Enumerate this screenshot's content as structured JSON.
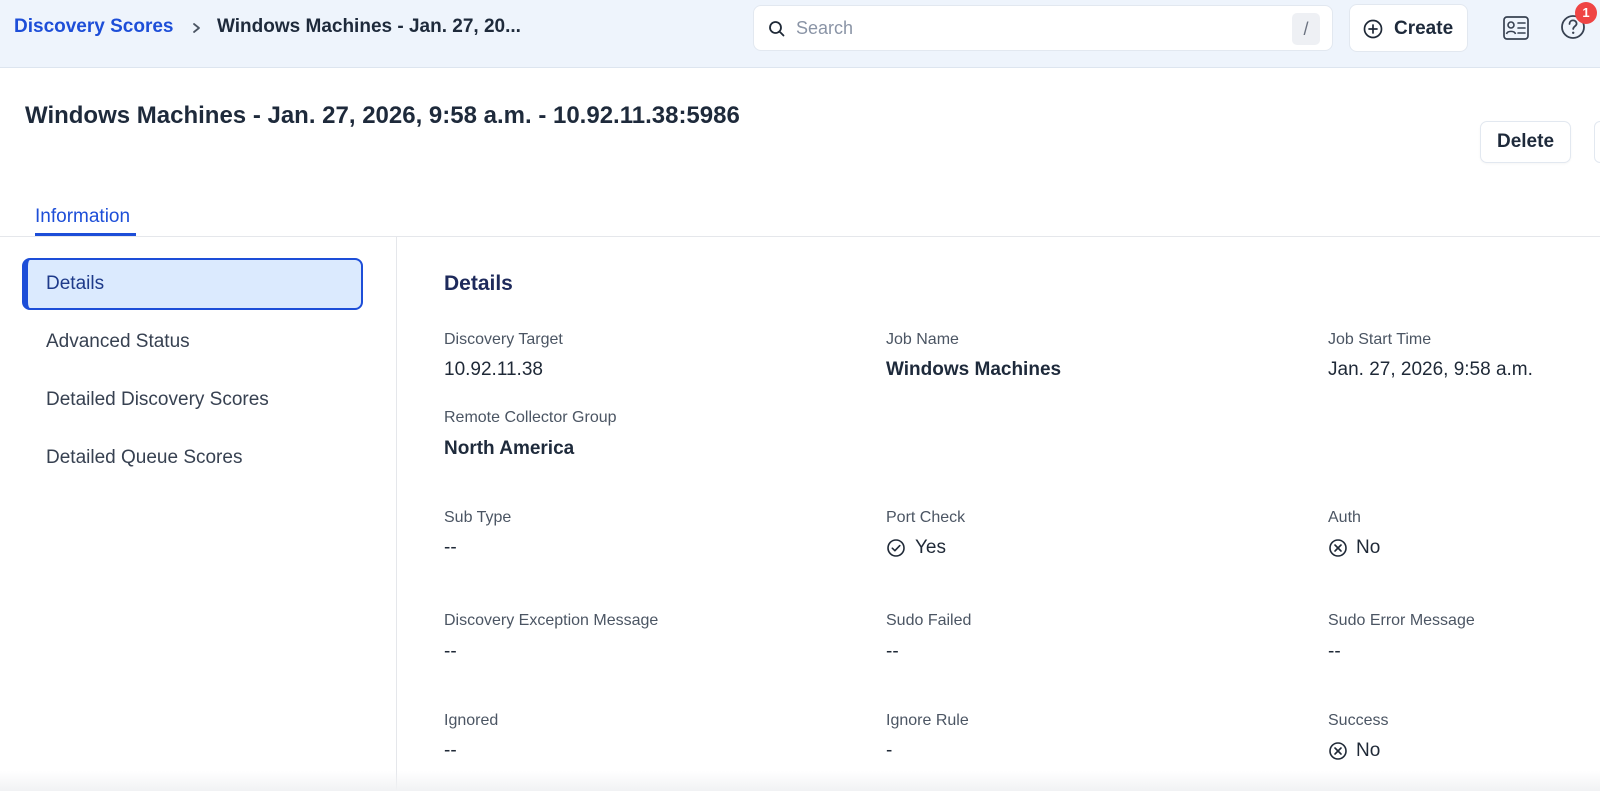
{
  "header": {
    "breadcrumb_link": "Discovery Scores",
    "breadcrumb_current": "Windows Machines - Jan. 27, 20...",
    "search_placeholder": "Search",
    "search_shortcut": "/",
    "create_label": "Create",
    "notification_count": "1"
  },
  "page": {
    "title": "Windows Machines - Jan. 27, 2026, 9:58 a.m. - 10.92.11.38:5986",
    "delete_label": "Delete",
    "tab_information": "Information"
  },
  "nav": {
    "items": [
      {
        "label": "Details",
        "active": true
      },
      {
        "label": "Advanced Status",
        "active": false
      },
      {
        "label": "Detailed Discovery Scores",
        "active": false
      },
      {
        "label": "Detailed Queue Scores",
        "active": false
      }
    ]
  },
  "details": {
    "title": "Details",
    "fields": {
      "discovery_target": {
        "label": "Discovery Target",
        "value": "10.92.11.38"
      },
      "job_name": {
        "label": "Job Name",
        "value": "Windows Machines"
      },
      "job_start_time": {
        "label": "Job Start Time",
        "value": "Jan. 27, 2026, 9:58 a.m."
      },
      "remote_collector_group": {
        "label": "Remote Collector Group",
        "value": "North America"
      },
      "sub_type": {
        "label": "Sub Type",
        "value": "--"
      },
      "port_check": {
        "label": "Port Check",
        "value": "Yes",
        "icon": "check-circle-icon"
      },
      "auth": {
        "label": "Auth",
        "value": "No",
        "icon": "x-circle-icon"
      },
      "discovery_exception_message": {
        "label": "Discovery Exception Message",
        "value": "--"
      },
      "sudo_failed": {
        "label": "Sudo Failed",
        "value": "--"
      },
      "sudo_error_message": {
        "label": "Sudo Error Message",
        "value": "--"
      },
      "ignored": {
        "label": "Ignored",
        "value": "--"
      },
      "ignore_rule": {
        "label": "Ignore Rule",
        "value": "-"
      },
      "success": {
        "label": "Success",
        "value": "No",
        "icon": "x-circle-icon"
      }
    }
  },
  "colors": {
    "accent": "#1d4ed8",
    "topbar_bg": "#eef4fc",
    "active_nav_bg": "#dbeafe",
    "badge": "#ef4444"
  }
}
